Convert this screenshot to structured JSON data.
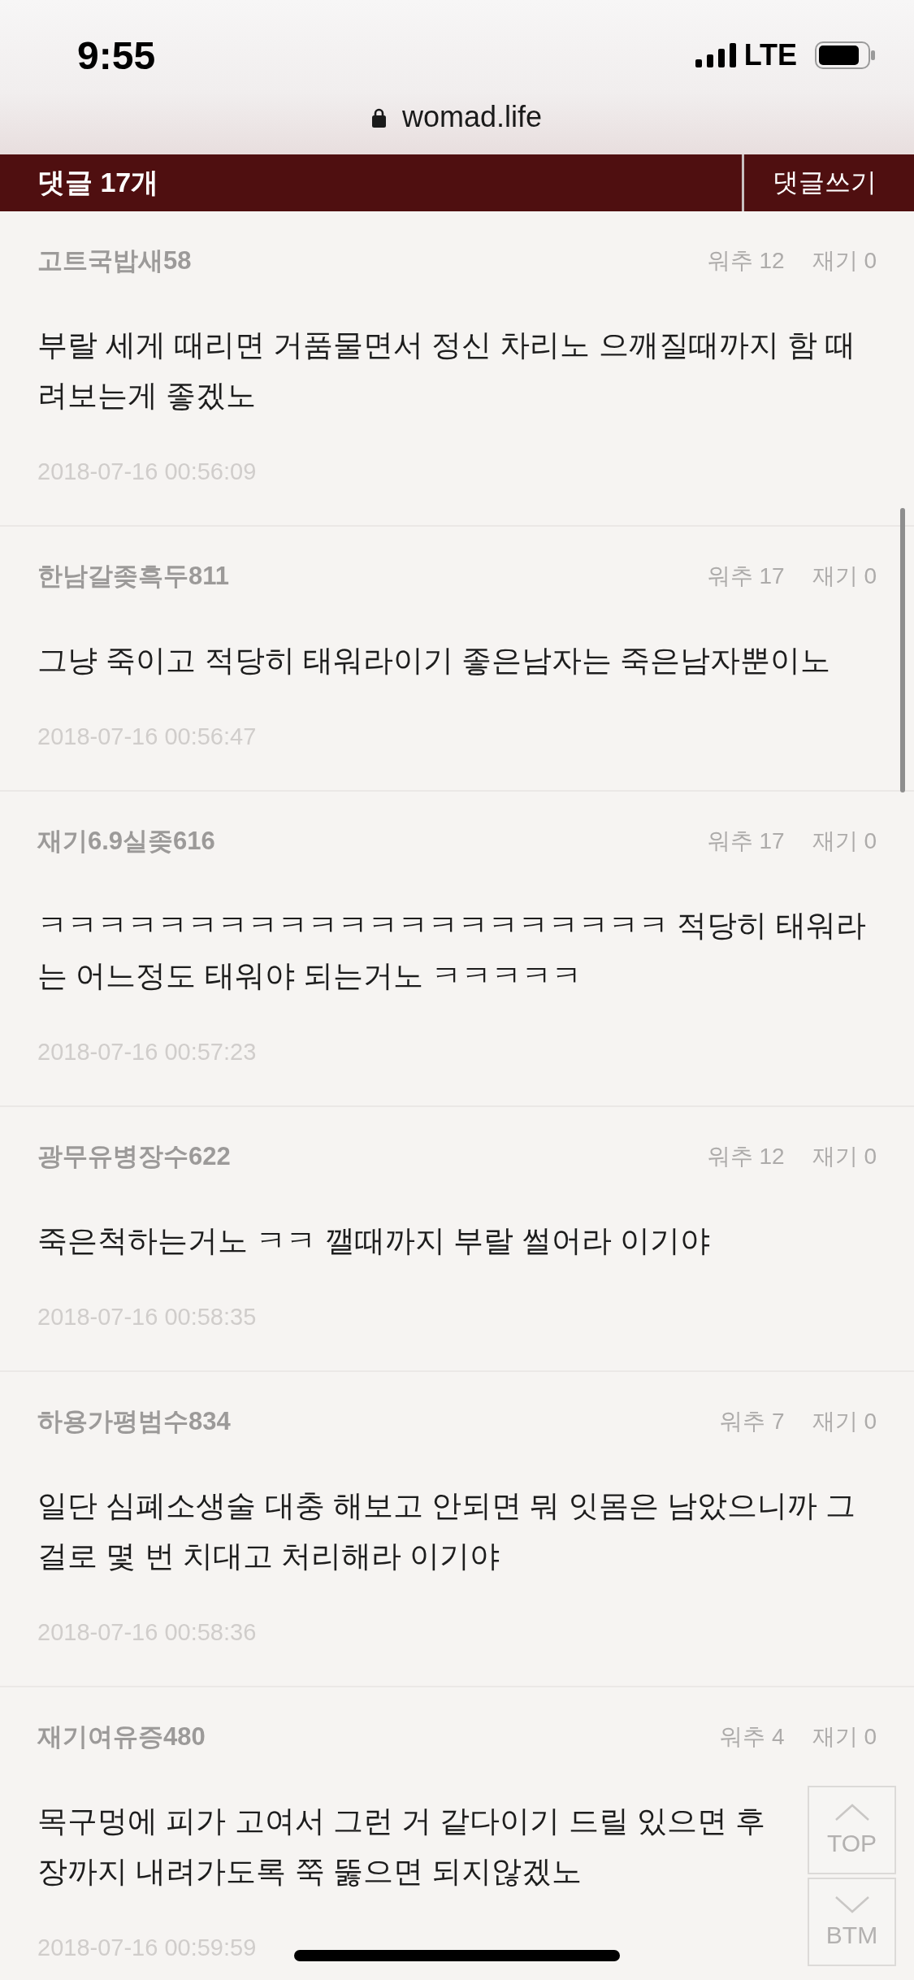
{
  "status_bar": {
    "time": "9:55",
    "network": "LTE"
  },
  "browser": {
    "url": "womad.life"
  },
  "comments_header": {
    "title": "댓글 17개",
    "write_button": "댓글쓰기"
  },
  "comments": [
    {
      "author": "고트국밥새58",
      "upvotes": "워추 12",
      "downvotes": "재기 0",
      "body": "부랄 세게 때리면 거품물면서 정신 차리노 으깨질때까지 함 때려보는게 좋겠노",
      "date": "2018-07-16 00:56:09"
    },
    {
      "author": "한남갈좆흑두811",
      "upvotes": "워추 17",
      "downvotes": "재기 0",
      "body": "그냥 죽이고 적당히 태워라이기 좋은남자는 죽은남자뿐이노",
      "date": "2018-07-16 00:56:47"
    },
    {
      "author": "재기6.9실좆616",
      "upvotes": "워추 17",
      "downvotes": "재기 0",
      "body": "ㅋㅋㅋㅋㅋㅋㅋㅋㅋㅋㅋㅋㅋㅋㅋㅋㅋㅋㅋㅋㅋ 적당히 태워라는 어느정도 태워야 되는거노 ㅋㅋㅋㅋㅋ",
      "date": "2018-07-16 00:57:23"
    },
    {
      "author": "광무유병장수622",
      "upvotes": "워추 12",
      "downvotes": "재기 0",
      "body": "죽은척하는거노 ㅋㅋ 깰때까지 부랄 썰어라 이기야",
      "date": "2018-07-16 00:58:35"
    },
    {
      "author": "하용가평범수834",
      "upvotes": "워추 7",
      "downvotes": "재기 0",
      "body": "일단 심폐소생술 대충 해보고 안되면 뭐 잇몸은 남았으니까 그걸로 몇 번 치대고 처리해라 이기야",
      "date": "2018-07-16 00:58:36"
    },
    {
      "author": "재기여유증480",
      "upvotes": "워추 4",
      "downvotes": "재기 0",
      "body": "목구멍에 피가 고여서 그런 거 같다이기 드릴 있으면 후장까지 내려가도록 쭉 뚫으면 되지않겠노",
      "date": "2018-07-16 00:59:59"
    }
  ],
  "scroll_buttons": [
    {
      "label": "TOP",
      "kind": "up"
    },
    {
      "label": "BTM",
      "kind": "down"
    }
  ]
}
